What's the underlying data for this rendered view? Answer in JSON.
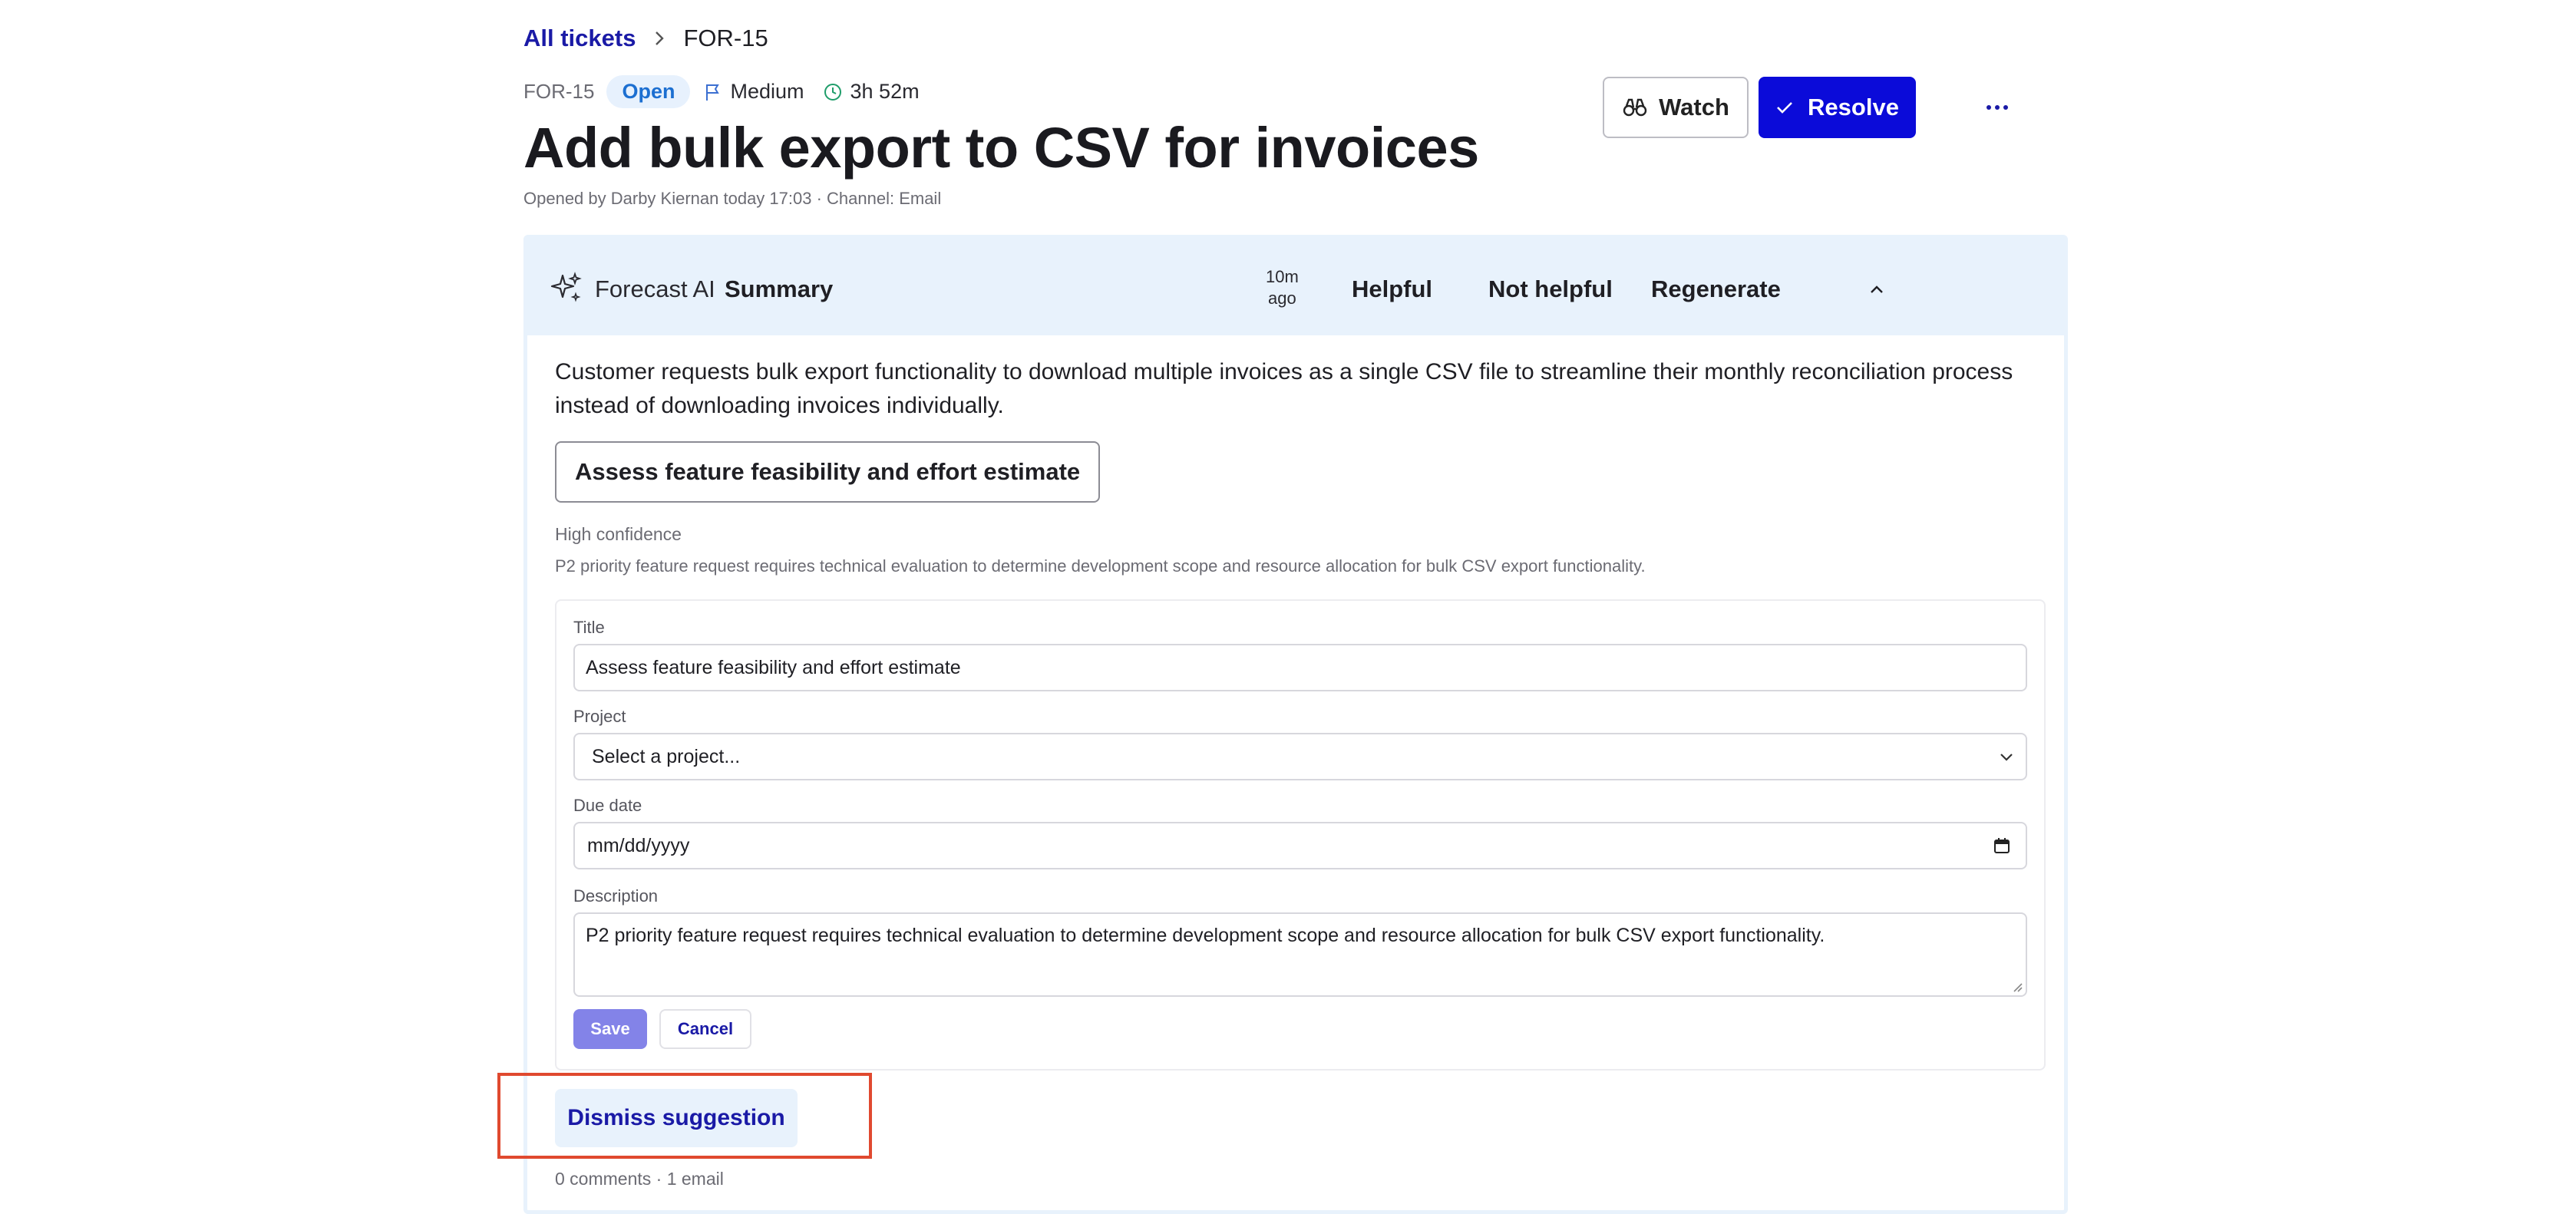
{
  "breadcrumb": {
    "root": "All tickets",
    "current": "FOR-15"
  },
  "ticket": {
    "id": "FOR-15",
    "status": "Open",
    "priority": "Medium",
    "time": "3h 52m",
    "title": "Add bulk export to CSV for invoices",
    "subtitle": "Opened by Darby Kiernan today 17:03 · Channel: Email"
  },
  "actions": {
    "watch": "Watch",
    "resolve": "Resolve",
    "more": "···"
  },
  "ai_panel": {
    "brand": "Forecast AI",
    "section": "Summary",
    "time_line1": "10m",
    "time_line2": "ago",
    "helpful": "Helpful",
    "not_helpful": "Not helpful",
    "regenerate": "Regenerate",
    "summary": "Customer requests bulk export functionality to download multiple invoices as a single CSV file to streamline their monthly reconciliation process instead of downloading invoices individually.",
    "suggestion": "Assess feature feasibility and effort estimate",
    "confidence": "High confidence",
    "reason": "P2 priority feature request requires technical evaluation to determine development scope and resource allocation for bulk CSV export functionality.",
    "dismiss": "Dismiss suggestion",
    "footer": "0 comments · 1 email"
  },
  "form": {
    "title_label": "Title",
    "title_value": "Assess feature feasibility and effort estimate",
    "project_label": "Project",
    "project_value": "Select a project...",
    "due_label": "Due date",
    "due_placeholder": "mm/dd/yyyy",
    "description_label": "Description",
    "description_value": "P2 priority feature request requires technical evaluation to determine development scope and resource allocation for bulk CSV export functionality.",
    "save": "Save",
    "cancel": "Cancel"
  },
  "colors": {
    "accent": "#0b0bd9",
    "link": "#1a1aa6",
    "panel_bg": "#e8f2fc",
    "status_open": "#1c6fd1",
    "highlight": "#e0492f"
  }
}
